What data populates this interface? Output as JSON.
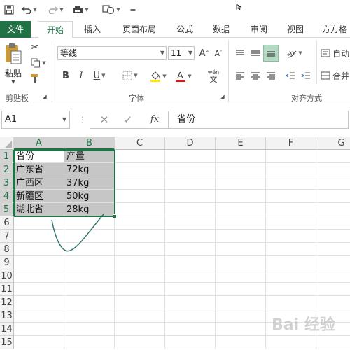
{
  "accent": "#217346",
  "quick_access": {
    "icons": [
      "save-icon",
      "undo-icon",
      "redo-icon",
      "toolbar-icon",
      "shapes-icon",
      "customize-icon"
    ],
    "customize_glyph": "="
  },
  "tabs": [
    "文件",
    "开始",
    "插入",
    "页面布局",
    "公式",
    "数据",
    "审阅",
    "视图",
    "方方格"
  ],
  "active_tab": "开始",
  "ribbon": {
    "clipboard": {
      "paste_label": "粘贴",
      "group_label": "剪贴板"
    },
    "font": {
      "font_name": "等线",
      "font_size": "11",
      "bold": "B",
      "italic": "I",
      "underline": "U",
      "wen_glyph": "wén",
      "wen_sub": "文",
      "group_label": "字体"
    },
    "alignment": {
      "wrap_label": "自动",
      "merge_label": "合并",
      "group_label": "对齐方式"
    }
  },
  "formula_bar": {
    "name_box": "A1",
    "fx_label": "fx",
    "formula_value": "省份"
  },
  "columns": [
    "A",
    "B",
    "C",
    "D",
    "E",
    "F",
    "G"
  ],
  "rows": [
    "1",
    "2",
    "3",
    "4",
    "5",
    "6",
    "7",
    "8",
    "9",
    "10",
    "11",
    "12",
    "13",
    "14",
    "15"
  ],
  "cells": [
    [
      "省份",
      "产量"
    ],
    [
      "广东省",
      "72kg"
    ],
    [
      "广西区",
      "37kg"
    ],
    [
      "新疆区",
      "50kg"
    ],
    [
      "湖北省",
      "28kg"
    ]
  ],
  "selection": "A1:B5"
}
